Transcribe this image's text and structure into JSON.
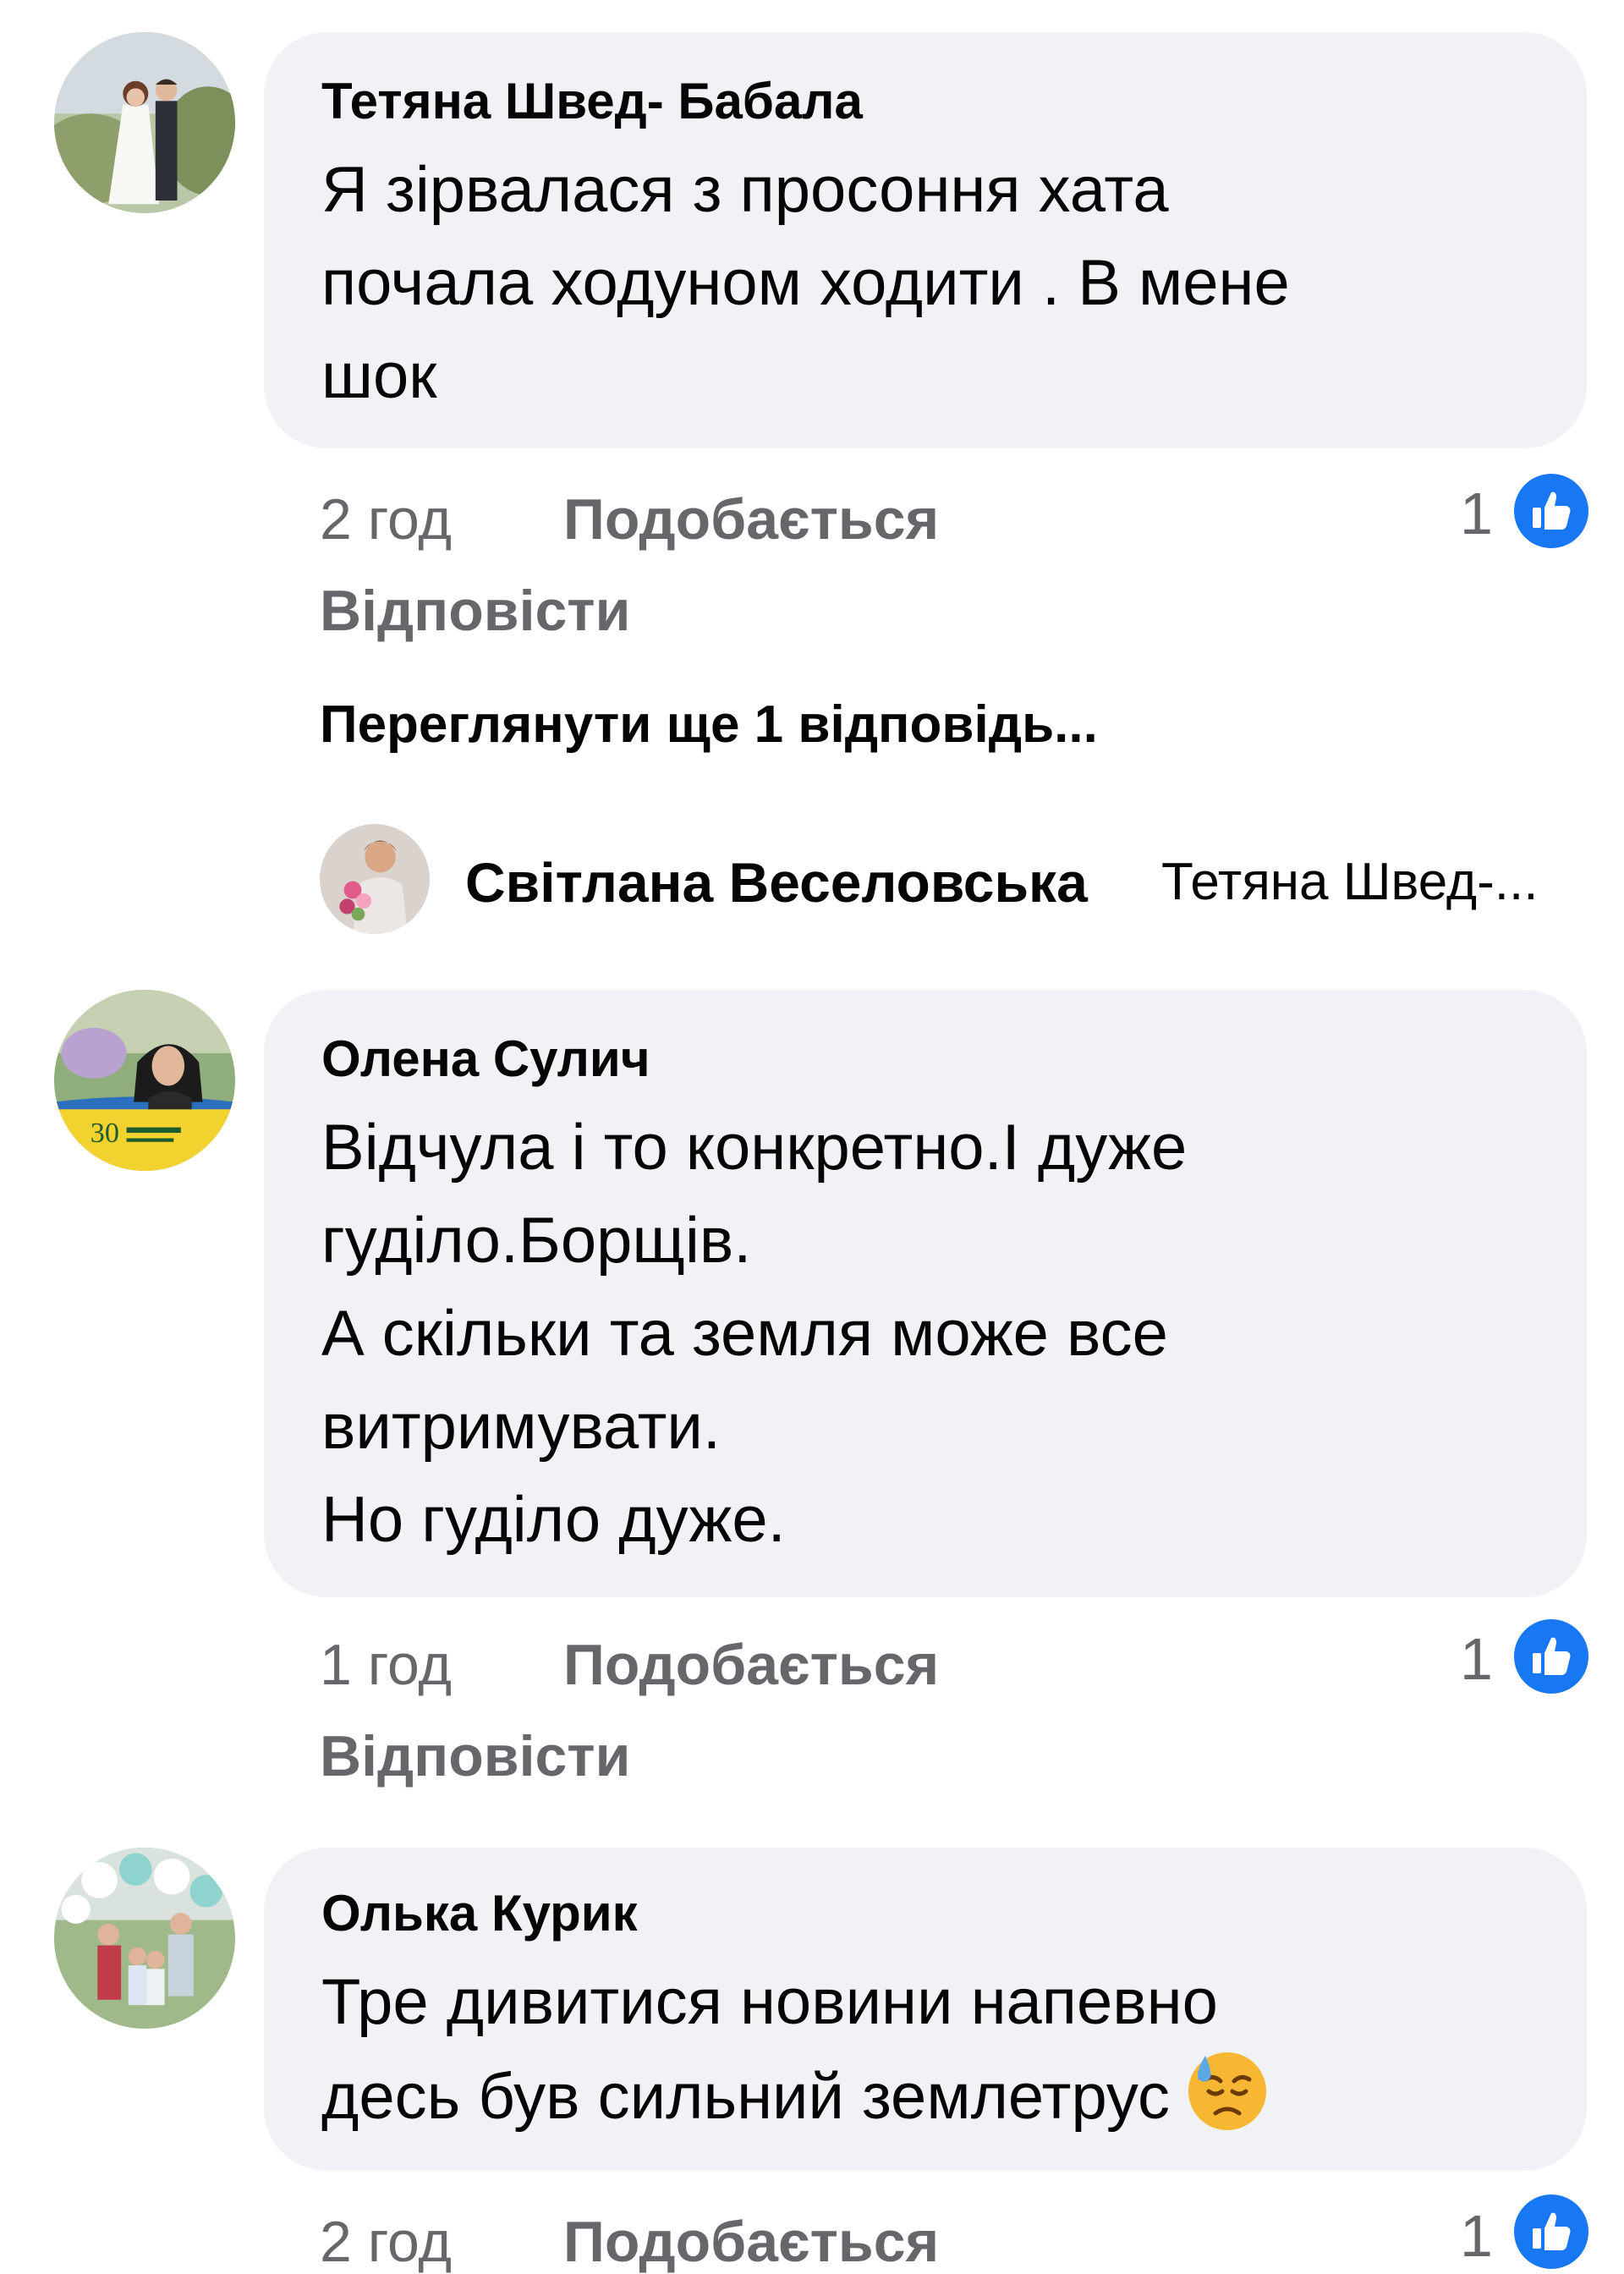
{
  "comments": [
    {
      "author": "Тетяна Швед- Бабала",
      "lines": [
        "Я зірвалася з просоння хата",
        "почала ходуном ходити . В мене",
        "шок"
      ],
      "time": "2 год",
      "like_label": "Подобається",
      "reply_label": "Відповісти",
      "like_count": "1",
      "avatar_icon": "wedding-couple-photo"
    },
    {
      "author": "Олена Сулич",
      "lines": [
        "Відчула і то конкретно.І дуже",
        "гуділо.Борщів.",
        "А скільки та земля може все",
        "витримувати.",
        "Но гуділо дуже."
      ],
      "time": "1 год",
      "like_label": "Подобається",
      "reply_label": "Відповісти",
      "like_count": "1",
      "avatar_icon": "woman-portrait-ukraine-frame"
    },
    {
      "author": "Олька Курик",
      "lines": [
        "Тре дивитися новини напевно",
        "десь був сильний землетрус"
      ],
      "time": "2 год",
      "like_label": "Подобається",
      "like_count": "1",
      "emoji": "downcast-face-with-sweat",
      "avatar_icon": "family-photo-balloons"
    }
  ],
  "view_more_replies": "Переглянути ще 1 відповідь...",
  "reply_preview": {
    "author": "Світлана Веселовська",
    "snippet": "Тетяна Швед-..."
  },
  "colors": {
    "bubble": "#f0f2f5",
    "secondary_text": "#65676b",
    "like_blue": "#1877f2"
  }
}
